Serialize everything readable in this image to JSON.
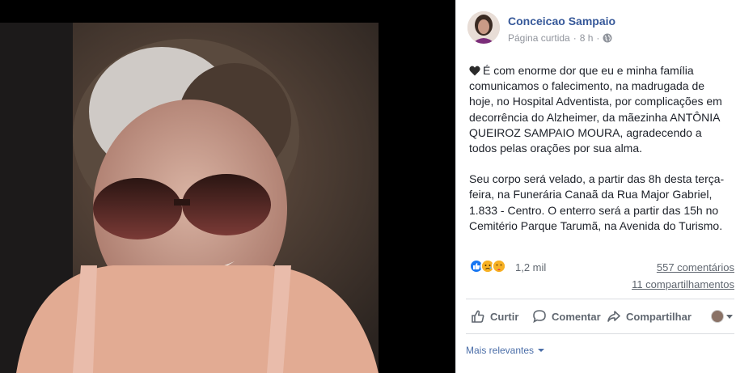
{
  "post": {
    "page_name": "Conceicao Sampaio",
    "category": "Página curtida",
    "separator": "·",
    "time": "8 h",
    "privacy_icon": "globe-icon",
    "emoji_icon": "black-heart-icon",
    "paragraph1": "É com enorme dor que eu e minha família comunicamos o falecimento, na madrugada de hoje, no Hospital Adventista, por complicações em decorrência do Alzheimer, da mãezinha ANTÔNIA QUEIROZ SAMPAIO MOURA, agradecendo a todos pelas orações por sua alma.",
    "paragraph2": "Seu corpo será velado, a partir das 8h desta terça-feira, na Funerária Canaã da Rua Major Gabriel, 1.833 - Centro. O enterro será a partir das 15h no Cemitério Parque Tarumã, na Avenida do Turismo."
  },
  "stats": {
    "reactions": [
      "like",
      "sad",
      "care"
    ],
    "reaction_count": "1,2 mil",
    "comments": "557 comentários",
    "shares": "11 compartilhamentos"
  },
  "actions": {
    "like": "Curtir",
    "comment": "Comentar",
    "share": "Compartilhar"
  },
  "comments_sort": {
    "label": "Mais relevantes"
  },
  "colors": {
    "link": "#365899",
    "like": "#1877f2",
    "sad": "#f7b125"
  }
}
